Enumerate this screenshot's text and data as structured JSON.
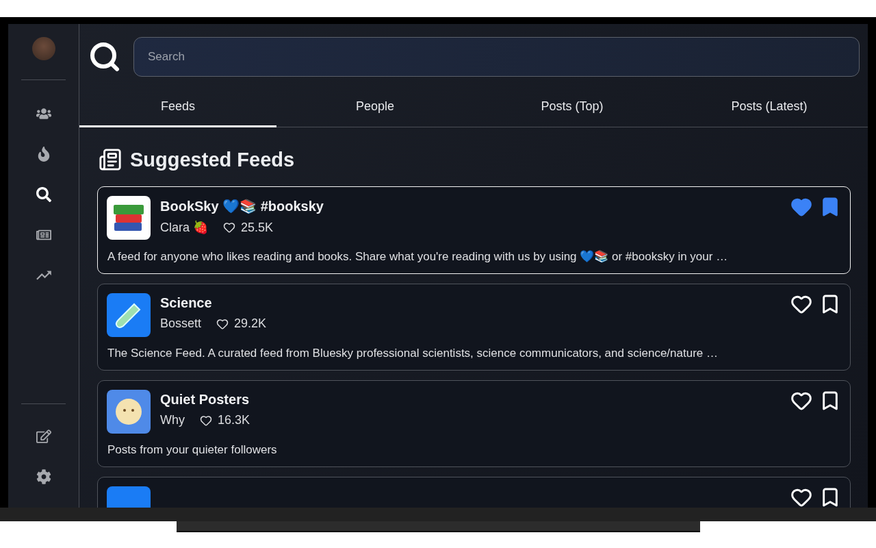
{
  "sidebar": {
    "items": [
      {
        "selected": false
      },
      {
        "selected": false
      },
      {
        "selected": true
      },
      {
        "selected": false
      },
      {
        "selected": false
      }
    ]
  },
  "search": {
    "placeholder": "Search"
  },
  "tabs": [
    {
      "label": "Feeds",
      "selected": true
    },
    {
      "label": "People",
      "selected": false
    },
    {
      "label": "Posts (Top)",
      "selected": false
    },
    {
      "label": "Posts (Latest)",
      "selected": false
    }
  ],
  "section_title": "Suggested Feeds",
  "feeds": [
    {
      "kind": "books",
      "color": "#ffffff",
      "title": "BookSky 💙📚 #booksky",
      "author": "Clara 🍓",
      "likes": "25.5K",
      "description": "A feed for anyone who likes reading and books. Share what you're reading with us by using 💙📚 or #booksky in your …",
      "selected": true,
      "liked": true,
      "saved": true
    },
    {
      "kind": "test-tube",
      "color": "#1a7cf5",
      "title": "Science",
      "author": "Bossett",
      "likes": "29.2K",
      "description": "The Science Feed. A curated feed from Bluesky professional scientists,  science communicators, and science/nature …",
      "selected": false,
      "liked": false,
      "saved": false
    },
    {
      "kind": "face",
      "color": "#4f8ae8",
      "title": "Quiet Posters",
      "author": "Why",
      "likes": "16.3K",
      "description": "Posts from your quieter followers",
      "selected": false,
      "liked": false,
      "saved": false
    },
    {
      "kind": "plain",
      "color": "#1a7cf5",
      "selected": false,
      "liked": false,
      "saved": false
    }
  ]
}
